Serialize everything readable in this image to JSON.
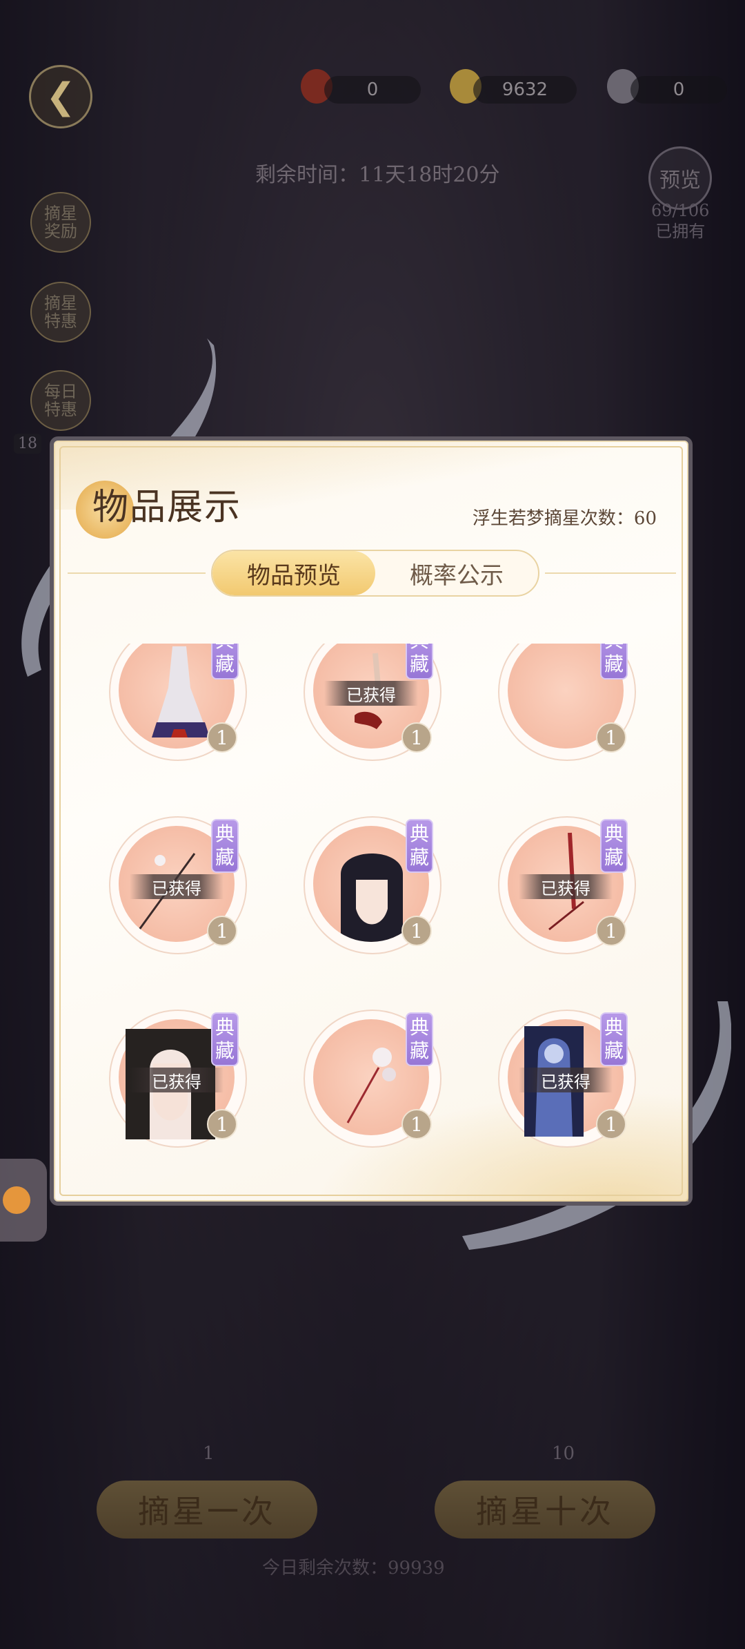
{
  "header": {
    "back_icon": "back-arrow-icon",
    "currencies": [
      {
        "icon": "red-gem-icon",
        "value": "0"
      },
      {
        "icon": "gold-coin-icon",
        "value": "9632"
      },
      {
        "icon": "silver-pearl-icon",
        "value": "0"
      }
    ],
    "timer": "剩余时间：11天18时20分",
    "preview_label": "预览",
    "owned_count": "69/106",
    "owned_label": "已拥有"
  },
  "side_buttons": [
    {
      "label": "摘星奖励"
    },
    {
      "label": "摘星特惠"
    },
    {
      "label": "每日特惠"
    }
  ],
  "side_count": "18",
  "modal": {
    "title": "物品展示",
    "pull_count": "浮生若梦摘星次数：60",
    "tabs": [
      "物品预览",
      "概率公示"
    ],
    "tag_label": "典藏",
    "owned_label": "已获得",
    "items": [
      {
        "name": "gown",
        "qty": "1",
        "owned": false
      },
      {
        "name": "shoes",
        "qty": "1",
        "owned": true
      },
      {
        "name": "empty",
        "qty": "1",
        "owned": false
      },
      {
        "name": "hairpin",
        "qty": "1",
        "owned": true
      },
      {
        "name": "black-hair",
        "qty": "1",
        "owned": false
      },
      {
        "name": "tassel-ornament",
        "qty": "1",
        "owned": true
      },
      {
        "name": "hairstyle",
        "qty": "1",
        "owned": true
      },
      {
        "name": "flower-hairpin",
        "qty": "1",
        "owned": false
      },
      {
        "name": "card-art",
        "qty": "1",
        "owned": true
      }
    ]
  },
  "bottom": {
    "single_cost": "1",
    "ten_cost": "10",
    "single_label": "摘星一次",
    "ten_label": "摘星十次",
    "remaining": "今日剩余次数：99939"
  },
  "colors": {
    "tag_purple": "#9776d6",
    "active_tab": "#f2c970",
    "title_brown": "#4a3322"
  }
}
